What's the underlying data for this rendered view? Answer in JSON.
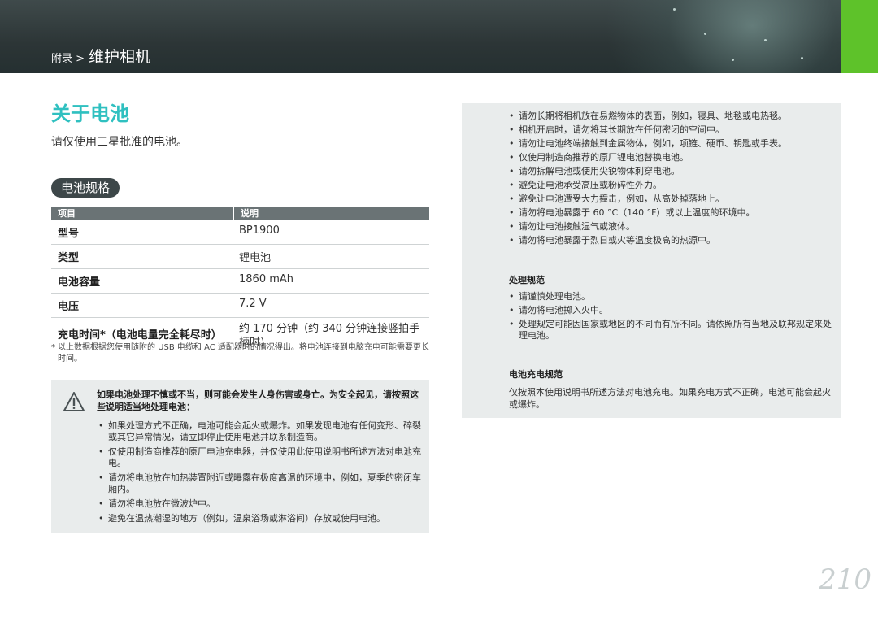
{
  "header": {
    "breadcrumb_small": "附录 >",
    "breadcrumb_big": "维护相机"
  },
  "title": "关于电池",
  "intro": "请仅使用三星批准的电池。",
  "spec_section": {
    "label": "电池规格",
    "columns": [
      "项目",
      "说明"
    ],
    "rows": [
      {
        "item": "型号",
        "desc": "BP1900"
      },
      {
        "item": "类型",
        "desc": "锂电池"
      },
      {
        "item": "电池容量",
        "desc": "1860 mAh"
      },
      {
        "item": "电压",
        "desc": "7.2 V"
      },
      {
        "item": "充电时间*（电池电量完全耗尽时）",
        "desc": "约 170 分钟（约 340 分钟连接竖拍手柄时）"
      }
    ],
    "footnote_mark": "*",
    "footnote": "以上数据根据您使用随附的 USB 电缆和 AC 适配器时的情况得出。将电池连接到电脑充电可能需要更长时间。"
  },
  "warning": {
    "icon": "warning-triangle-icon",
    "heading": "如果电池处理不慎或不当，则可能会发生人身伤害或身亡。为安全起见，请按照这些说明适当地处理电池：",
    "items": [
      "如果处理方式不正确，电池可能会起火或爆炸。如果发现电池有任何变形、碎裂或其它异常情况，请立即停止使用电池并联系制造商。",
      "仅使用制造商推荐的原厂电池充电器，并仅使用此使用说明书所述方法对电池充电。",
      "请勿将电池放在加热装置附近或曝露在极度高温的环境中，例如，夏季的密闭车厢内。",
      "请勿将电池放在微波炉中。",
      "避免在温热潮湿的地方（例如，温泉浴场或淋浴间）存放或使用电池。"
    ]
  },
  "right_box": {
    "items": [
      "请勿长期将相机放在易燃物体的表面，例如，寝具、地毯或电热毯。",
      "相机开启时，请勿将其长期放在任何密闭的空间中。",
      "请勿让电池终端接触到金属物体，例如，项链、硬币、钥匙或手表。",
      "仅使用制造商推荐的原厂锂电池替换电池。",
      "请勿拆解电池或使用尖锐物体刺穿电池。",
      "避免让电池承受高压或粉碎性外力。",
      "避免让电池遭受大力撞击，例如，从高处掉落地上。",
      "请勿将电池暴露于 60 °C（140 °F）或以上温度的环境中。",
      "请勿让电池接触湿气或液体。",
      "请勿将电池暴露于烈日或火等温度极高的热源中。"
    ],
    "disposal_heading": "处理规范",
    "disposal_items": [
      "请谨慎处理电池。",
      "请勿将电池掷入火中。",
      "处理规定可能因国家或地区的不同而有所不同。请依照所有当地及联邦规定来处理电池。"
    ],
    "charging_heading": "电池充电规范",
    "charging_text": "仅按照本使用说明书所述方法对电池充电。如果充电方式不正确，电池可能会起火或爆炸。"
  },
  "page_number": "210",
  "colors": {
    "accent": "#2fc0c0",
    "tab_green": "#5ec22a",
    "banner": "#2c3536",
    "box_bg": "#e9ecec"
  }
}
